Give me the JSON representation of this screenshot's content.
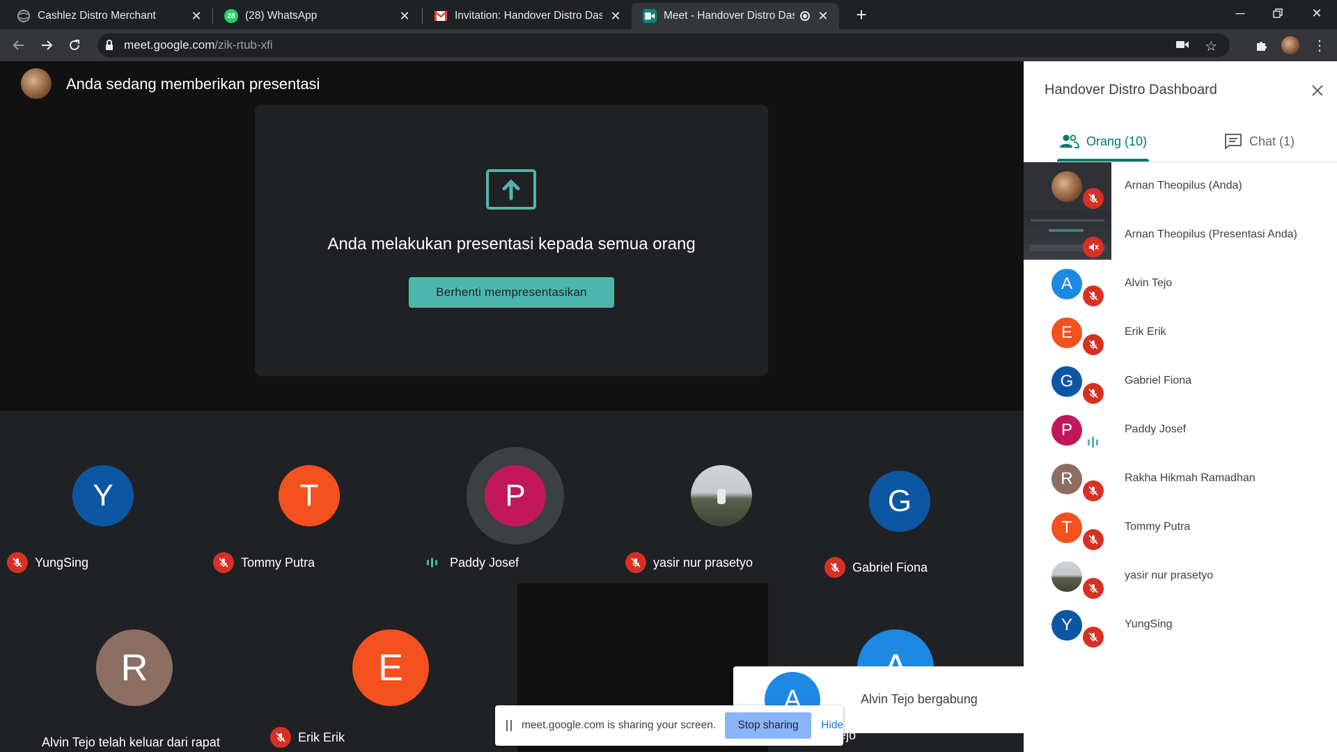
{
  "tabs": [
    {
      "label": "Cashlez Distro Merchant"
    },
    {
      "label": "(28) WhatsApp",
      "badge": "28"
    },
    {
      "label": "Invitation: Handover Distro Dashbo"
    },
    {
      "label": "Meet - Handover Distro Dashb"
    }
  ],
  "address": {
    "host": "meet.google.com",
    "path": "/zik-rtub-xfi"
  },
  "presenting": {
    "title": "Anda sedang memberikan presentasi",
    "message": "Anda melakukan presentasi kepada semua orang",
    "stop_button": "Berhenti mempresentasikan"
  },
  "tiles_row1": [
    {
      "name": "YungSing",
      "initial": "Y",
      "color": "#0b57a4",
      "status": "muted"
    },
    {
      "name": "Tommy Putra",
      "initial": "T",
      "color": "#f4511e",
      "status": "muted"
    },
    {
      "name": "Paddy Josef",
      "initial": "P",
      "color": "#c2185b",
      "status": "speaking"
    },
    {
      "name": "yasir nur prasetyo",
      "initial": "",
      "color": "#6b6f63",
      "status": "muted"
    },
    {
      "name": "Gabriel Fiona",
      "initial": "G",
      "color": "#0b57a4",
      "status": "muted"
    }
  ],
  "tiles_row2": [
    {
      "name": "Alvin Tejo telah keluar dari rapat",
      "initial": "R",
      "color": "#8d6e63"
    },
    {
      "name": "Erik Erik",
      "initial": "E",
      "color": "#f4511e"
    },
    {
      "name": "ejo",
      "initial": "A",
      "color": "#1e88e5"
    }
  ],
  "notification": {
    "initial": "A",
    "text": "Alvin Tejo bergabung"
  },
  "share_bar": {
    "text": "meet.google.com is sharing your screen.",
    "stop": "Stop sharing",
    "hide": "Hide"
  },
  "side_panel": {
    "title": "Handover Distro Dashboard",
    "tab_people": "Orang (10)",
    "tab_chat": "Chat (1)",
    "participants": [
      {
        "name": "Arnan Theopilus (Anda)",
        "initial": "",
        "color": "#8a5a3a",
        "status": "muted"
      },
      {
        "name": "Arnan Theopilus (Presentasi Anda)",
        "initial": "",
        "color": "#303134",
        "status": "presenting"
      },
      {
        "name": "Alvin Tejo",
        "initial": "A",
        "color": "#1e88e5",
        "status": "muted"
      },
      {
        "name": "Erik Erik",
        "initial": "E",
        "color": "#f4511e",
        "status": "muted"
      },
      {
        "name": "Gabriel Fiona",
        "initial": "G",
        "color": "#0b57a4",
        "status": "muted"
      },
      {
        "name": "Paddy Josef",
        "initial": "P",
        "color": "#c2185b",
        "status": "speaking"
      },
      {
        "name": "Rakha Hikmah Ramadhan",
        "initial": "R",
        "color": "#8d6e63",
        "status": "muted"
      },
      {
        "name": "Tommy Putra",
        "initial": "T",
        "color": "#f4511e",
        "status": "muted"
      },
      {
        "name": "yasir nur prasetyo",
        "initial": "",
        "color": "#6b6f63",
        "status": "muted"
      },
      {
        "name": "YungSing",
        "initial": "Y",
        "color": "#0b57a4",
        "status": "muted"
      }
    ]
  },
  "colors": {
    "accent": "#00796b",
    "button": "#4db6ac",
    "muted": "#d93025",
    "speaking": "#4db6ac"
  }
}
